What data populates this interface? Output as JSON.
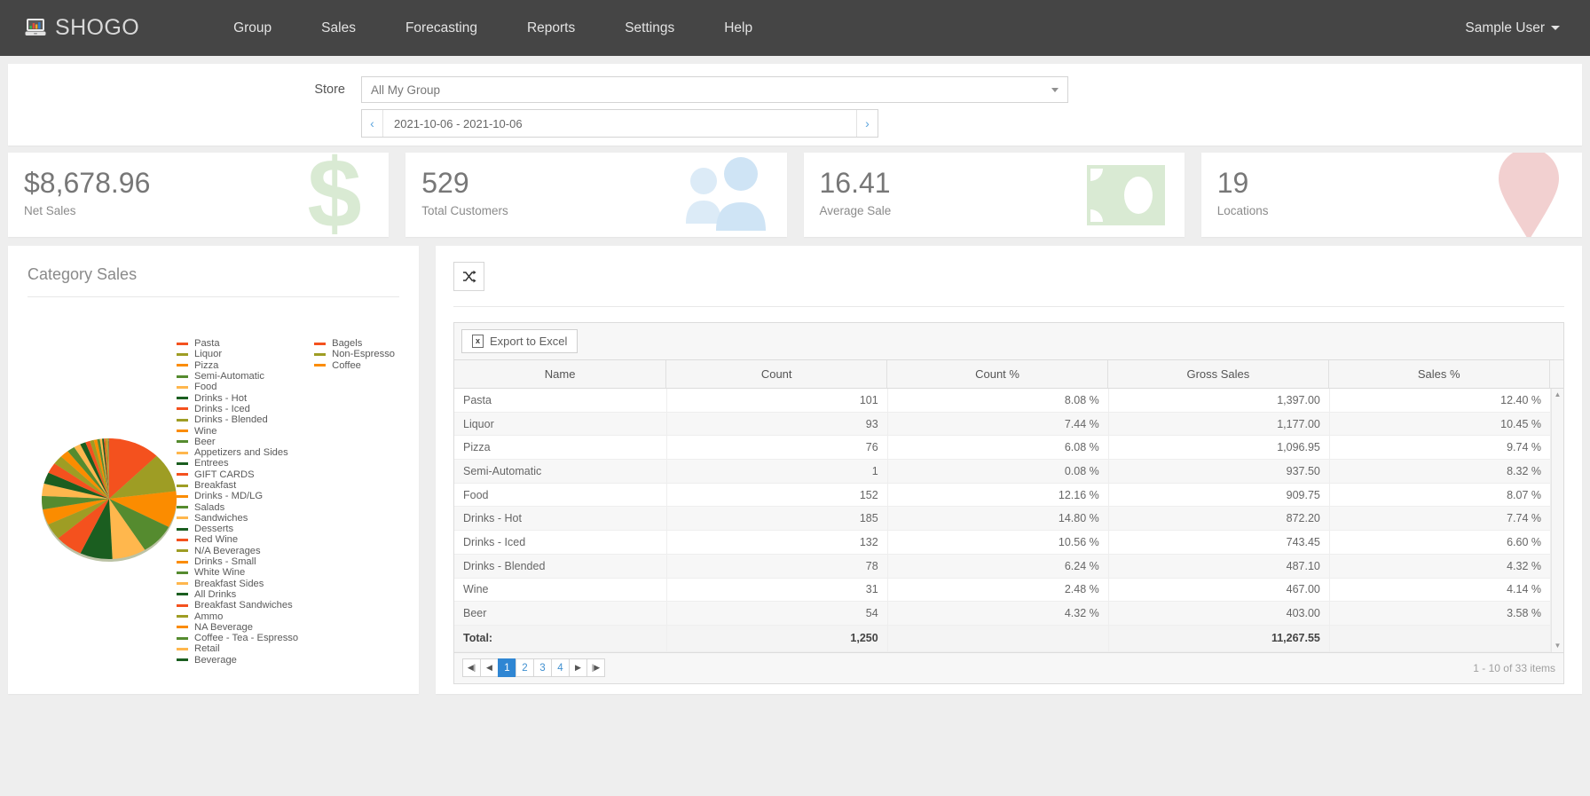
{
  "navbar": {
    "brand": "SHOGO",
    "brand_icon": "monitor-chart-icon",
    "links": [
      "Group",
      "Sales",
      "Forecasting",
      "Reports",
      "Settings",
      "Help"
    ],
    "user": "Sample User"
  },
  "filters": {
    "store_label": "Store",
    "store_value": "All My Group",
    "store_placeholder": "All My Group",
    "date_range": "2021-10-06 - 2021-10-06",
    "prev_icon": "chevron-left-icon",
    "next_icon": "chevron-right-icon"
  },
  "kpis": [
    {
      "value": "$8,678.96",
      "label": "Net Sales",
      "icon": "dollar-sign-icon",
      "color": "#d9ead3"
    },
    {
      "value": "529",
      "label": "Total Customers",
      "icon": "people-icon",
      "color": "#dcebf7"
    },
    {
      "value": "16.41",
      "label": "Average Sale",
      "icon": "money-bill-icon",
      "color": "#d9ead3"
    },
    {
      "value": "19",
      "label": "Locations",
      "icon": "map-pin-icon",
      "color": "#f2d0d0"
    }
  ],
  "chart_panel": {
    "title": "Category Sales"
  },
  "chart_data": {
    "type": "pie",
    "title": "Category Sales",
    "legend_position": "right",
    "palette": [
      "#F4511E",
      "#9E9D24",
      "#FB8C00",
      "#558B2F",
      "#FFB74D",
      "#1B5E20"
    ],
    "legend_columns": [
      [
        "Pasta",
        "Liquor",
        "Pizza",
        "Semi-Automatic",
        "Food",
        "Drinks - Hot",
        "Drinks - Iced",
        "Drinks - Blended",
        "Wine",
        "Beer",
        "Appetizers and Sides",
        "Entrees",
        "GIFT CARDS",
        "Breakfast",
        "Drinks - MD/LG",
        "Salads",
        "Sandwiches",
        "Desserts",
        "Red Wine",
        "N/A Beverages",
        "Drinks - Small",
        "White Wine",
        "Breakfast Sides",
        "All Drinks",
        "Breakfast Sandwiches",
        "Ammo",
        "NA Beverage",
        "Coffee - Tea - Espresso",
        "Retail",
        "Beverage"
      ],
      [
        "Bagels",
        "Non-Espresso",
        "Coffee"
      ]
    ],
    "categories": [
      "Pasta",
      "Liquor",
      "Pizza",
      "Semi-Automatic",
      "Food",
      "Drinks - Hot",
      "Drinks - Iced",
      "Drinks - Blended",
      "Wine",
      "Beer",
      "Appetizers and Sides",
      "Entrees",
      "GIFT CARDS",
      "Breakfast",
      "Drinks - MD/LG",
      "Salads",
      "Sandwiches",
      "Desserts",
      "Red Wine",
      "N/A Beverages",
      "Drinks - Small",
      "White Wine",
      "Breakfast Sides",
      "All Drinks",
      "Breakfast Sandwiches",
      "Ammo",
      "NA Beverage",
      "Coffee - Tea - Espresso",
      "Retail",
      "Beverage",
      "Bagels",
      "Non-Espresso",
      "Coffee"
    ],
    "values": [
      12.4,
      10.45,
      9.74,
      8.32,
      8.07,
      7.74,
      6.6,
      4.32,
      4.14,
      3.58,
      3.3,
      3.05,
      2.8,
      2.4,
      2.1,
      1.85,
      1.6,
      1.35,
      1.1,
      0.95,
      0.8,
      0.65,
      0.52,
      0.42,
      0.33,
      0.26,
      0.2,
      0.15,
      0.11,
      0.08,
      0.06,
      0.04,
      0.02
    ],
    "ylabel": "Sales %"
  },
  "table_panel": {
    "shuffle_icon": "shuffle-icon",
    "export_label": "Export to Excel",
    "export_icon": "excel-file-icon",
    "columns": [
      "Name",
      "Count",
      "Count %",
      "Gross Sales",
      "Sales %"
    ],
    "rows": [
      [
        "Pasta",
        "101",
        "8.08 %",
        "1,397.00",
        "12.40 %"
      ],
      [
        "Liquor",
        "93",
        "7.44 %",
        "1,177.00",
        "10.45 %"
      ],
      [
        "Pizza",
        "76",
        "6.08 %",
        "1,096.95",
        "9.74 %"
      ],
      [
        "Semi-Automatic",
        "1",
        "0.08 %",
        "937.50",
        "8.32 %"
      ],
      [
        "Food",
        "152",
        "12.16 %",
        "909.75",
        "8.07 %"
      ],
      [
        "Drinks - Hot",
        "185",
        "14.80 %",
        "872.20",
        "7.74 %"
      ],
      [
        "Drinks - Iced",
        "132",
        "10.56 %",
        "743.45",
        "6.60 %"
      ],
      [
        "Drinks - Blended",
        "78",
        "6.24 %",
        "487.10",
        "4.32 %"
      ],
      [
        "Wine",
        "31",
        "2.48 %",
        "467.00",
        "4.14 %"
      ],
      [
        "Beer",
        "54",
        "4.32 %",
        "403.00",
        "3.58 %"
      ]
    ],
    "total_label": "Total:",
    "total_count": "1,250",
    "total_gross": "11,267.55",
    "pager": {
      "first_icon": "first-page-icon",
      "prev_icon": "prev-page-icon",
      "pages": [
        "1",
        "2",
        "3",
        "4"
      ],
      "active_page": "1",
      "next_icon": "next-page-icon",
      "last_icon": "last-page-icon",
      "info": "1 - 10 of 33 items"
    }
  },
  "theme": {
    "nav_bg": "#454545",
    "page_bg": "#eeeeee",
    "accent_blue": "#2f86d3"
  }
}
